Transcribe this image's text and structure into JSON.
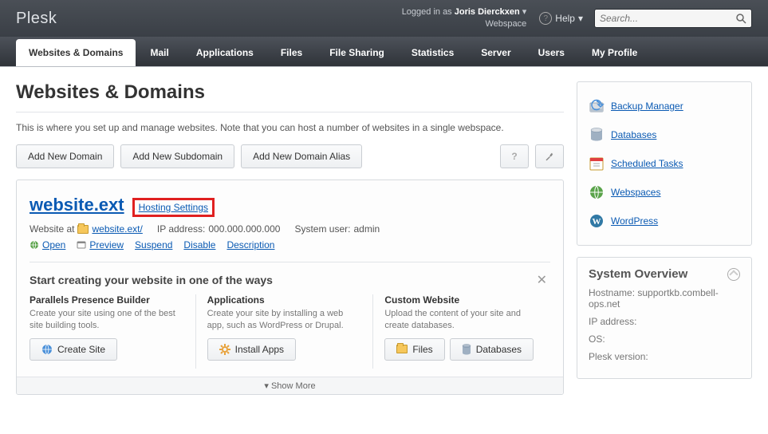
{
  "header": {
    "logo": "Plesk",
    "logged_in_prefix": "Logged in as",
    "username": "Joris Dierckxen",
    "subscription": "Webspace",
    "help_label": "Help",
    "search_placeholder": "Search..."
  },
  "nav": {
    "tabs": [
      {
        "label": "Websites & Domains",
        "active": true
      },
      {
        "label": "Mail"
      },
      {
        "label": "Applications"
      },
      {
        "label": "Files"
      },
      {
        "label": "File Sharing"
      },
      {
        "label": "Statistics"
      },
      {
        "label": "Server"
      },
      {
        "label": "Users"
      },
      {
        "label": "My Profile"
      }
    ]
  },
  "page": {
    "title": "Websites & Domains",
    "intro": "This is where you set up and manage websites. Note that you can host a number of websites in a single webspace.",
    "buttons": {
      "add_domain": "Add New Domain",
      "add_subdomain": "Add New Subdomain",
      "add_alias": "Add New Domain Alias"
    }
  },
  "domain": {
    "name": "website.ext",
    "hosting_settings": "Hosting Settings",
    "website_at_label": "Website at",
    "docroot": "website.ext/",
    "ip_label": "IP address:",
    "ip_value": "000.000.000.000",
    "sysuser_label": "System user:",
    "sysuser_value": "admin",
    "actions": {
      "open": "Open",
      "preview": "Preview",
      "suspend": "Suspend",
      "disable": "Disable",
      "description": "Description"
    }
  },
  "start": {
    "title": "Start creating your website in one of the ways",
    "presence": {
      "title": "Parallels Presence Builder",
      "desc": "Create your site using one of the best site building tools.",
      "btn": "Create Site"
    },
    "apps": {
      "title": "Applications",
      "desc": "Create your site by installing a web app, such as WordPress or Drupal.",
      "btn": "Install Apps"
    },
    "custom": {
      "title": "Custom Website",
      "desc": "Upload the content of your site and create databases.",
      "btn_files": "Files",
      "btn_db": "Databases"
    },
    "show_more": "Show More"
  },
  "sidebar": {
    "tools": [
      {
        "label": "Backup Manager",
        "icon": "backup"
      },
      {
        "label": "Databases",
        "icon": "database"
      },
      {
        "label": "Scheduled Tasks",
        "icon": "calendar"
      },
      {
        "label": "Webspaces",
        "icon": "webspace"
      },
      {
        "label": "WordPress",
        "icon": "wordpress"
      }
    ],
    "overview": {
      "title": "System Overview",
      "hostname_label": "Hostname:",
      "hostname_value": "supportkb.combell-ops.net",
      "ip_label": "IP address:",
      "os_label": "OS:",
      "plesk_label": "Plesk version:"
    }
  }
}
